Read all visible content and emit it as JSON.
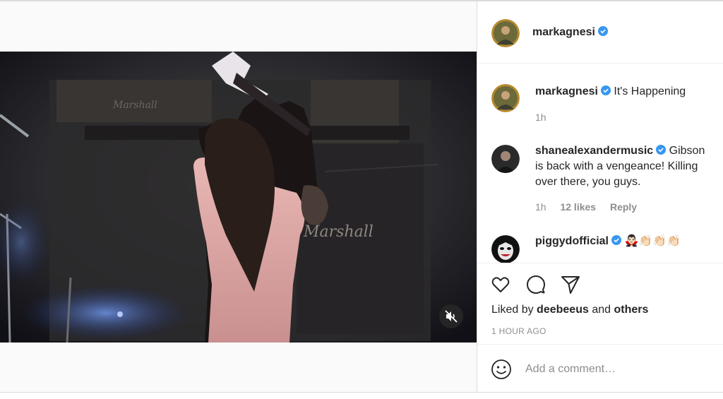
{
  "post": {
    "author": "markagnesi",
    "video": {
      "amp_text_1": "Marshall",
      "amp_text_2": "Marshall"
    }
  },
  "comments": [
    {
      "user": "markagnesi",
      "text": "It's Happening",
      "time": "1h"
    },
    {
      "user": "shanealexandermusic",
      "line1": "Gibson",
      "line2": "is back with a vengeance! Killing",
      "line3": "over there, you guys.",
      "time": "1h",
      "likes": "12 likes",
      "reply": "Reply"
    },
    {
      "user": "piggydofficial",
      "emoji": "🧛🏻‍♂️👏🏻👏🏻👏🏻"
    }
  ],
  "likes": {
    "prefix": "Liked by",
    "user": "deebeeus",
    "and": "and",
    "others": "others"
  },
  "timestamp": "1 HOUR AGO",
  "add_comment": {
    "placeholder": "Add a comment…"
  },
  "colors": {
    "verified": "#3897f0",
    "muted_text": "#8e8e8e",
    "text": "#262626"
  },
  "icons": [
    "heart-icon",
    "comment-icon",
    "share-icon",
    "emoji-icon",
    "mute-icon",
    "verified-icon"
  ]
}
